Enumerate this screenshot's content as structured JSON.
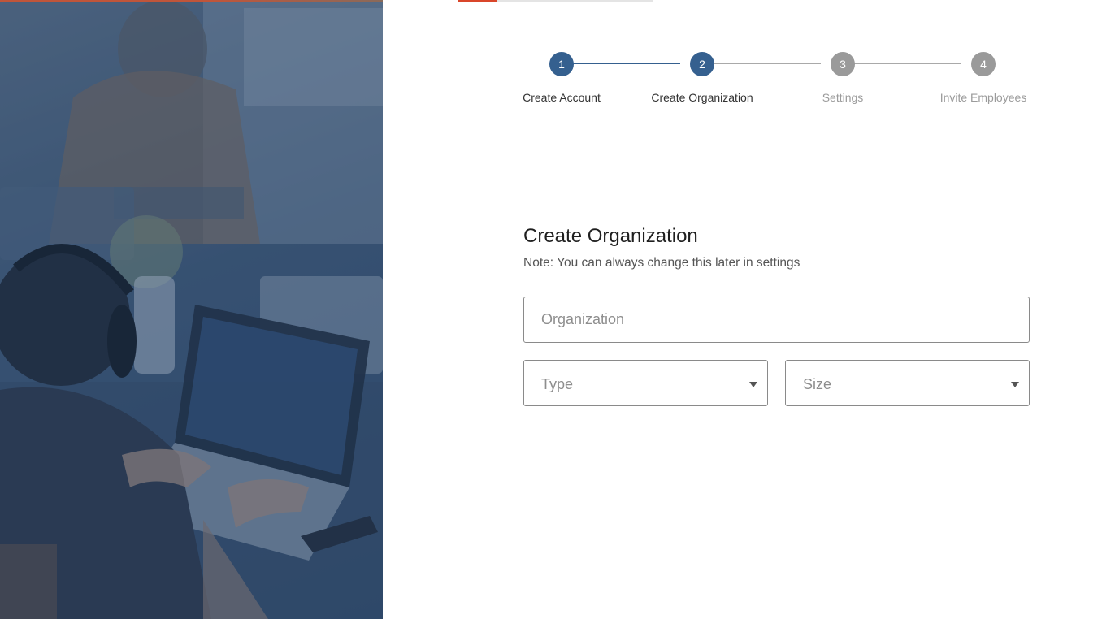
{
  "top_progress": {
    "fraction": 0.2
  },
  "stepper": {
    "steps": [
      {
        "number": "1",
        "label": "Create Account",
        "active": true
      },
      {
        "number": "2",
        "label": "Create Organization",
        "active": true
      },
      {
        "number": "3",
        "label": "Settings",
        "active": false
      },
      {
        "number": "4",
        "label": "Invite Employees",
        "active": false
      }
    ]
  },
  "form": {
    "title": "Create Organization",
    "note": "Note: You can always change this later in settings",
    "organization": {
      "placeholder": "Organization",
      "value": ""
    },
    "type": {
      "label": "Type",
      "icon": "chevron-down-icon"
    },
    "size": {
      "label": "Size",
      "icon": "chevron-down-icon"
    }
  },
  "colors": {
    "primary": "#35608f",
    "inactive": "#9a9a9a",
    "accent": "#d9462a"
  }
}
